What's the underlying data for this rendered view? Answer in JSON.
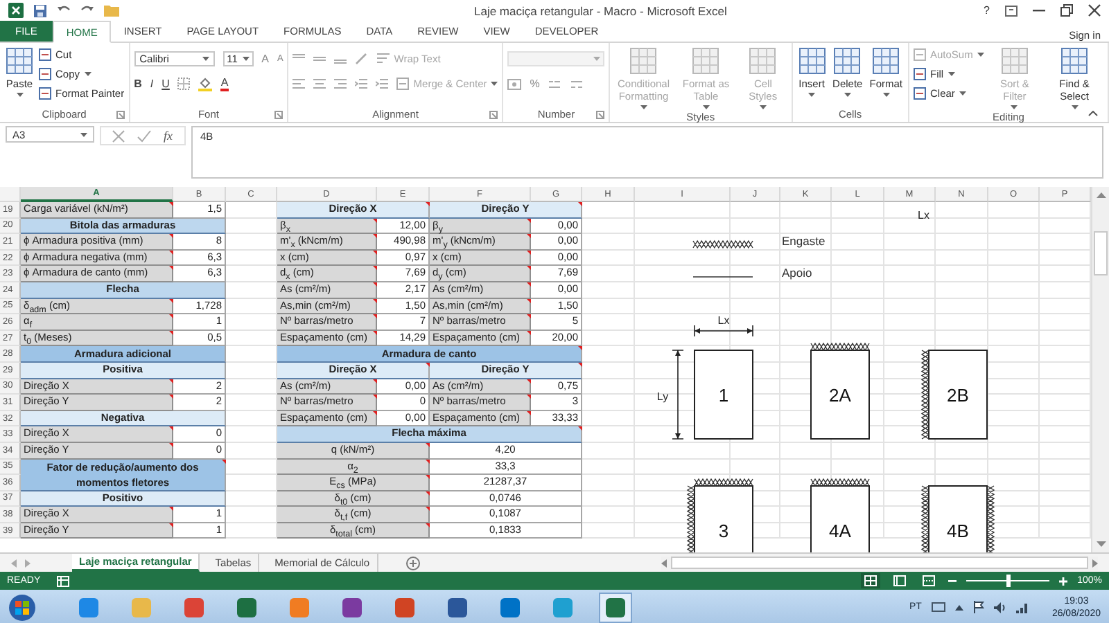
{
  "window": {
    "title": "Laje maciça retangular - Macro - Microsoft Excel",
    "help": "?"
  },
  "tabs": [
    {
      "label": "FILE",
      "kind": "file",
      "selected": false
    },
    {
      "label": "HOME",
      "kind": "tab",
      "selected": true
    },
    {
      "label": "INSERT",
      "kind": "tab",
      "selected": false
    },
    {
      "label": "PAGE LAYOUT",
      "kind": "tab",
      "selected": false
    },
    {
      "label": "FORMULAS",
      "kind": "tab",
      "selected": false
    },
    {
      "label": "DATA",
      "kind": "tab",
      "selected": false
    },
    {
      "label": "REVIEW",
      "kind": "tab",
      "selected": false
    },
    {
      "label": "VIEW",
      "kind": "tab",
      "selected": false
    },
    {
      "label": "DEVELOPER",
      "kind": "tab",
      "selected": false
    }
  ],
  "sign_in": "Sign in",
  "ribbon": {
    "groups": [
      {
        "kind": "buttons",
        "label": "Clipboard",
        "launcher": true,
        "items": [
          {
            "kind": "large",
            "label": "Paste",
            "disabled": false,
            "caret": true
          },
          {
            "kind": "small",
            "label": "Cut",
            "disabled": false,
            "caret": false
          },
          {
            "kind": "small",
            "label": "Copy",
            "disabled": false,
            "caret": true
          },
          {
            "kind": "small",
            "label": "Format Painter",
            "disabled": false,
            "caret": false
          }
        ]
      },
      {
        "kind": "font",
        "label": "Font",
        "launcher": true,
        "font_name": "Calibri",
        "font_size": "11",
        "size_buttons": [
          "A",
          "A"
        ],
        "format_buttons": [
          "B",
          "I",
          "U"
        ],
        "color_button": "A"
      },
      {
        "kind": "alignment",
        "label": "Alignment",
        "launcher": true,
        "wrap_text": {
          "label": "Wrap Text",
          "disabled": true
        },
        "merge": {
          "label": "Merge & Center",
          "disabled": true
        }
      },
      {
        "kind": "number",
        "label": "Number",
        "launcher": true,
        "format_disabled": true,
        "percent": "%"
      },
      {
        "kind": "buttons",
        "label": "Styles",
        "launcher": false,
        "items": [
          {
            "kind": "large",
            "label": "Conditional Formatting",
            "disabled": true,
            "caret": true
          },
          {
            "kind": "large",
            "label": "Format as Table",
            "disabled": true,
            "caret": true
          },
          {
            "kind": "large",
            "label": "Cell Styles",
            "disabled": true,
            "caret": true
          }
        ]
      },
      {
        "kind": "buttons",
        "label": "Cells",
        "launcher": false,
        "items": [
          {
            "kind": "large",
            "label": "Insert",
            "disabled": false,
            "caret": true
          },
          {
            "kind": "large",
            "label": "Delete",
            "disabled": false,
            "caret": true
          },
          {
            "kind": "large",
            "label": "Format",
            "disabled": false,
            "caret": true
          }
        ]
      },
      {
        "kind": "buttons",
        "label": "Editing",
        "launcher": false,
        "items": [
          {
            "kind": "small",
            "label": "AutoSum",
            "disabled": true,
            "caret": true
          },
          {
            "kind": "small",
            "label": "Fill",
            "disabled": false,
            "caret": true
          },
          {
            "kind": "small",
            "label": "Clear",
            "disabled": false,
            "caret": true
          },
          {
            "kind": "large",
            "label": "Sort & Filter",
            "disabled": true,
            "caret": true
          },
          {
            "kind": "large",
            "label": "Find & Select",
            "disabled": false,
            "caret": true
          }
        ]
      }
    ]
  },
  "formula_bar": {
    "name_box": "A3",
    "fx": "fx",
    "value": "4B"
  },
  "sheet": {
    "columns": [
      {
        "label": "A",
        "selected": true
      },
      {
        "label": "B",
        "selected": false
      },
      {
        "label": "C",
        "selected": false
      },
      {
        "label": "D",
        "selected": false
      },
      {
        "label": "E",
        "selected": false
      },
      {
        "label": "F",
        "selected": false
      },
      {
        "label": "G",
        "selected": false
      },
      {
        "label": "H",
        "selected": false
      },
      {
        "label": "I",
        "selected": false
      },
      {
        "label": "J",
        "selected": false
      },
      {
        "label": "K",
        "selected": false
      },
      {
        "label": "L",
        "selected": false
      },
      {
        "label": "M",
        "selected": false
      },
      {
        "label": "N",
        "selected": false
      },
      {
        "label": "O",
        "selected": false
      },
      {
        "label": "P",
        "selected": false
      }
    ],
    "rows": [
      {
        "number": "19",
        "left": [
          {
            "text": "Carga variável (kN/m²)",
            "kind": "label",
            "comment": true
          },
          {
            "text": "1,5",
            "kind": "value",
            "comment": false
          }
        ],
        "right": [
          {
            "text": "Direção X",
            "kind": "subheader",
            "comment": true
          },
          {
            "text": "Direção Y",
            "kind": "subheader",
            "comment": true
          }
        ]
      },
      {
        "number": "20",
        "left": [
          {
            "text": "Bitola das armaduras",
            "kind": "header",
            "comment": false
          }
        ],
        "right": [
          {
            "text": "β$_{x}$",
            "kind": "label",
            "comment": true
          },
          {
            "text": "12,00",
            "kind": "value",
            "comment": false
          },
          {
            "text": "β$_{y}$",
            "kind": "label",
            "comment": true
          },
          {
            "text": "0,00",
            "kind": "value",
            "comment": false
          }
        ]
      },
      {
        "number": "21",
        "left": [
          {
            "text": "ϕ Armadura positiva (mm)",
            "kind": "label",
            "comment": true
          },
          {
            "text": "8",
            "kind": "value",
            "comment": false
          }
        ],
        "right": [
          {
            "text": "m'$_{x}$ (kNcm/m)",
            "kind": "label",
            "comment": true
          },
          {
            "text": "490,98",
            "kind": "value",
            "comment": false
          },
          {
            "text": "m'$_{y}$ (kNcm/m)",
            "kind": "label",
            "comment": true
          },
          {
            "text": "0,00",
            "kind": "value",
            "comment": false
          }
        ]
      },
      {
        "number": "22",
        "left": [
          {
            "text": "ϕ Armadura negativa (mm)",
            "kind": "label",
            "comment": true
          },
          {
            "text": "6,3",
            "kind": "value",
            "comment": false
          }
        ],
        "right": [
          {
            "text": "x (cm)",
            "kind": "label",
            "comment": true
          },
          {
            "text": "0,97",
            "kind": "value",
            "comment": false
          },
          {
            "text": "x (cm)",
            "kind": "label",
            "comment": true
          },
          {
            "text": "0,00",
            "kind": "value",
            "comment": false
          }
        ]
      },
      {
        "number": "23",
        "left": [
          {
            "text": "ϕ Armadura de canto (mm)",
            "kind": "label",
            "comment": true
          },
          {
            "text": "6,3",
            "kind": "value",
            "comment": false
          }
        ],
        "right": [
          {
            "text": "d$_{x}$ (cm)",
            "kind": "label",
            "comment": true
          },
          {
            "text": "7,69",
            "kind": "value",
            "comment": false
          },
          {
            "text": "d$_{y}$ (cm)",
            "kind": "label",
            "comment": true
          },
          {
            "text": "7,69",
            "kind": "value",
            "comment": false
          }
        ]
      },
      {
        "number": "24",
        "left": [
          {
            "text": "Flecha",
            "kind": "header",
            "comment": false
          }
        ],
        "right": [
          {
            "text": "As (cm²/m)",
            "kind": "label",
            "comment": true
          },
          {
            "text": "2,17",
            "kind": "value",
            "comment": false
          },
          {
            "text": "As (cm²/m)",
            "kind": "label",
            "comment": true
          },
          {
            "text": "0,00",
            "kind": "value",
            "comment": false
          }
        ]
      },
      {
        "number": "25",
        "left": [
          {
            "text": "δ$_{adm}$ (cm)",
            "kind": "label",
            "comment": true
          },
          {
            "text": "1,728",
            "kind": "value",
            "comment": false
          }
        ],
        "right": [
          {
            "text": "As,min (cm²/m)",
            "kind": "label",
            "comment": true
          },
          {
            "text": "1,50",
            "kind": "value",
            "comment": false
          },
          {
            "text": "As,min (cm²/m)",
            "kind": "label",
            "comment": true
          },
          {
            "text": "1,50",
            "kind": "value",
            "comment": false
          }
        ]
      },
      {
        "number": "26",
        "left": [
          {
            "text": "α$_{f}$",
            "kind": "label",
            "comment": true
          },
          {
            "text": "1",
            "kind": "value",
            "comment": false
          }
        ],
        "right": [
          {
            "text": "Nº barras/metro",
            "kind": "label",
            "comment": true
          },
          {
            "text": "7",
            "kind": "value",
            "comment": false
          },
          {
            "text": "Nº barras/metro",
            "kind": "label",
            "comment": true
          },
          {
            "text": "5",
            "kind": "value",
            "comment": false
          }
        ]
      },
      {
        "number": "27",
        "left": [
          {
            "text": "t$_{0}$ (Meses)",
            "kind": "label",
            "comment": true
          },
          {
            "text": "0,5",
            "kind": "value",
            "comment": false
          }
        ],
        "right": [
          {
            "text": "Espaçamento (cm)",
            "kind": "label",
            "comment": true
          },
          {
            "text": "14,29",
            "kind": "value",
            "comment": false
          },
          {
            "text": "Espaçamento (cm)",
            "kind": "label",
            "comment": true
          },
          {
            "text": "20,00",
            "kind": "value",
            "comment": false
          }
        ]
      },
      {
        "number": "28",
        "left": [
          {
            "text": "Armadura adicional",
            "kind": "section",
            "comment": false
          }
        ],
        "right": [
          {
            "text": "Armadura de canto",
            "kind": "section",
            "comment": true
          }
        ]
      },
      {
        "number": "29",
        "left": [
          {
            "text": "Positiva",
            "kind": "subheader",
            "comment": false
          }
        ],
        "right": [
          {
            "text": "Direção X",
            "kind": "subheader",
            "comment": true
          },
          {
            "text": "Direção Y",
            "kind": "subheader",
            "comment": true
          }
        ]
      },
      {
        "number": "30",
        "left": [
          {
            "text": "Direção X",
            "kind": "label",
            "comment": true
          },
          {
            "text": "2",
            "kind": "value",
            "comment": false
          }
        ],
        "right": [
          {
            "text": "As (cm²/m)",
            "kind": "label",
            "comment": true
          },
          {
            "text": "0,00",
            "kind": "value",
            "comment": false
          },
          {
            "text": "As (cm²/m)",
            "kind": "label",
            "comment": true
          },
          {
            "text": "0,75",
            "kind": "value",
            "comment": false
          }
        ]
      },
      {
        "number": "31",
        "left": [
          {
            "text": "Direção Y",
            "kind": "label",
            "comment": true
          },
          {
            "text": "2",
            "kind": "value",
            "comment": false
          }
        ],
        "right": [
          {
            "text": "Nº barras/metro",
            "kind": "label",
            "comment": true
          },
          {
            "text": "0",
            "kind": "value",
            "comment": false
          },
          {
            "text": "Nº barras/metro",
            "kind": "label",
            "comment": true
          },
          {
            "text": "3",
            "kind": "value",
            "comment": false
          }
        ]
      },
      {
        "number": "32",
        "left": [
          {
            "text": "Negativa",
            "kind": "subheader",
            "comment": false
          }
        ],
        "right": [
          {
            "text": "Espaçamento (cm)",
            "kind": "label",
            "comment": true
          },
          {
            "text": "0,00",
            "kind": "value",
            "comment": false
          },
          {
            "text": "Espaçamento (cm)",
            "kind": "label",
            "comment": true
          },
          {
            "text": "33,33",
            "kind": "value",
            "comment": false
          }
        ]
      },
      {
        "number": "33",
        "left": [
          {
            "text": "Direção X",
            "kind": "label",
            "comment": true
          },
          {
            "text": "0",
            "kind": "value",
            "comment": false
          }
        ],
        "right": [
          {
            "text": "Flecha máxima",
            "kind": "header",
            "comment": true
          }
        ]
      },
      {
        "number": "34",
        "left": [
          {
            "text": "Direção Y",
            "kind": "label",
            "comment": true
          },
          {
            "text": "0",
            "kind": "value",
            "comment": false
          }
        ],
        "right": [
          {
            "text": "q (kN/m²)",
            "kind": "label-center",
            "comment": true
          },
          {
            "text": "4,20",
            "kind": "value-center",
            "comment": false
          }
        ]
      },
      {
        "number": "35",
        "left": [
          {
            "text": "Fator de redução/aumento dos momentos fletores",
            "kind": "section",
            "comment": true
          }
        ],
        "right": [
          {
            "text": "α$_{2}$",
            "kind": "label-center",
            "comment": true
          },
          {
            "text": "33,3",
            "kind": "value-center",
            "comment": false
          }
        ]
      },
      {
        "number": "36",
        "right": [
          {
            "text": "E$_{cs}$ (MPa)",
            "kind": "label-center",
            "comment": true
          },
          {
            "text": "21287,37",
            "kind": "value-center",
            "comment": false
          }
        ]
      },
      {
        "number": "37",
        "left": [
          {
            "text": "Positivo",
            "kind": "subheader",
            "comment": false
          }
        ],
        "right": [
          {
            "text": "δ$_{t0}$ (cm)",
            "kind": "label-center",
            "comment": true
          },
          {
            "text": "0,0746",
            "kind": "value-center",
            "comment": false
          }
        ]
      },
      {
        "number": "38",
        "left": [
          {
            "text": "Direção X",
            "kind": "label",
            "comment": true
          },
          {
            "text": "1",
            "kind": "value",
            "comment": false
          }
        ],
        "right": [
          {
            "text": "δ$_{t,f}$ (cm)",
            "kind": "label-center",
            "comment": true
          },
          {
            "text": "0,1087",
            "kind": "value-center",
            "comment": false
          }
        ]
      },
      {
        "number": "39",
        "left": [
          {
            "text": "Direção Y",
            "kind": "label",
            "comment": true
          },
          {
            "text": "1",
            "kind": "value",
            "comment": false
          }
        ],
        "right": [
          {
            "text": "δ$_{total}$ (cm)",
            "kind": "label-center",
            "comment": true
          },
          {
            "text": "0,1833",
            "kind": "value-center",
            "comment": false
          }
        ]
      }
    ]
  },
  "drawing": {
    "top_label": "Lx",
    "legend": [
      {
        "kind": "fixed",
        "label": "Engaste"
      },
      {
        "kind": "support",
        "label": "Apoio"
      }
    ],
    "dimension_x": "Lx",
    "dimension_y": "Ly",
    "panels": [
      {
        "label": "1",
        "fixed_top": false,
        "fixed_left": false,
        "fixed_right": false
      },
      {
        "label": "2A",
        "fixed_top": true,
        "fixed_left": false,
        "fixed_right": false
      },
      {
        "label": "2B",
        "fixed_top": false,
        "fixed_left": true,
        "fixed_right": false
      },
      {
        "label": "3",
        "fixed_top": true,
        "fixed_left": true,
        "fixed_right": false
      },
      {
        "label": "4A",
        "fixed_top": true,
        "fixed_left": false,
        "fixed_right": false
      },
      {
        "label": "4B",
        "fixed_top": false,
        "fixed_left": true,
        "fixed_right": true
      }
    ]
  },
  "sheet_tabs": [
    {
      "label": "Laje maciça retangular",
      "selected": true
    },
    {
      "label": "Tabelas",
      "selected": false
    },
    {
      "label": "Memorial de Cálculo",
      "selected": false
    }
  ],
  "status_bar": {
    "status": "READY",
    "views": [
      {
        "selected": true
      },
      {
        "selected": false
      },
      {
        "selected": false
      }
    ],
    "zoom": {
      "level": 0.5,
      "value": "100%"
    }
  },
  "taskbar": {
    "apps": [
      {
        "color": "#1e88e5",
        "selected": false
      },
      {
        "color": "#e8b84a",
        "selected": false
      },
      {
        "color": "#db4437",
        "selected": false
      },
      {
        "color": "#1d6f42",
        "selected": false
      },
      {
        "color": "#f07c22",
        "selected": false
      },
      {
        "color": "#7b3aa0",
        "selected": false
      },
      {
        "color": "#d04423",
        "selected": false
      },
      {
        "color": "#2b579a",
        "selected": false
      },
      {
        "color": "#0072c6",
        "selected": false
      },
      {
        "color": "#1fa0d0",
        "selected": false
      },
      {
        "color": "#217346",
        "selected": true
      }
    ],
    "language": "PT",
    "time": "19:03",
    "date": "26/08/2020"
  }
}
